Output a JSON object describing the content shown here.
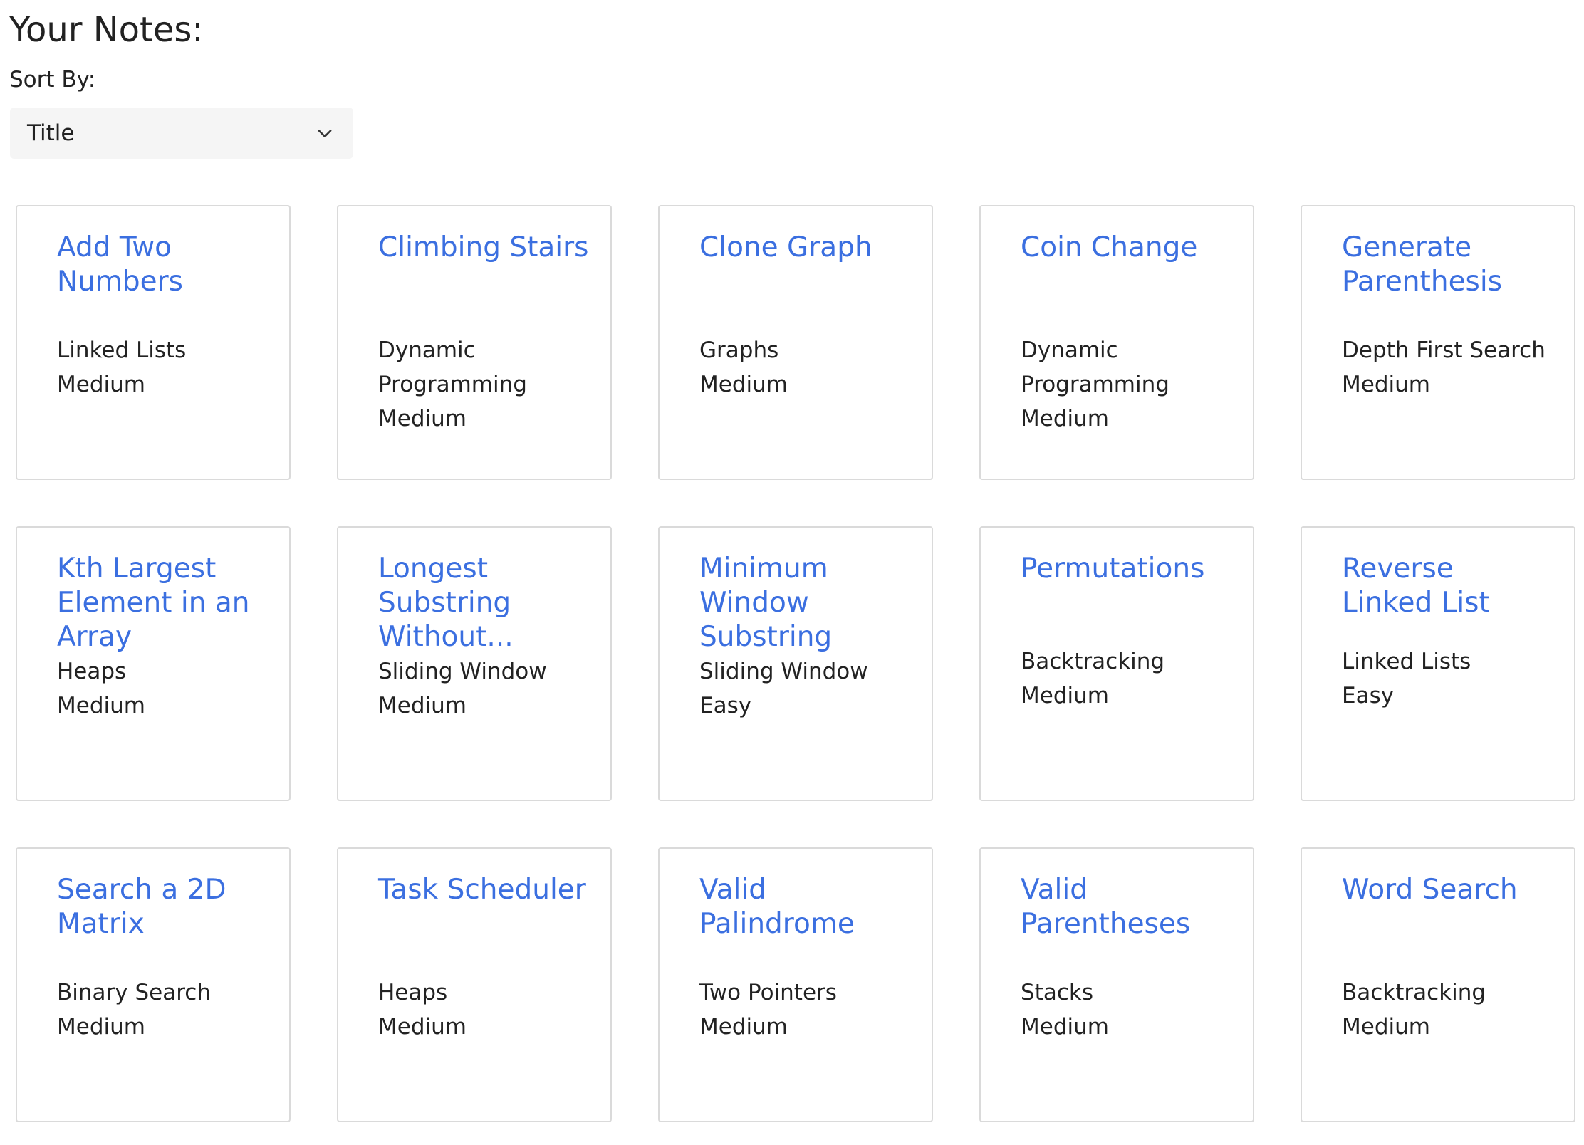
{
  "header": {
    "title": "Your Notes:",
    "sort_label": "Sort By:",
    "sort_value": "Title",
    "sort_icon": "chevron-down-icon"
  },
  "colors": {
    "link": "#3b6fe0",
    "text": "#222222",
    "card_border": "#dadada",
    "select_bg": "#f5f5f5"
  },
  "notes": [
    {
      "title": "Add Two Numbers",
      "category": "Linked Lists",
      "difficulty": "Medium"
    },
    {
      "title": "Climbing Stairs",
      "category": "Dynamic Programming",
      "difficulty": "Medium"
    },
    {
      "title": "Clone Graph",
      "category": "Graphs",
      "difficulty": "Medium"
    },
    {
      "title": "Coin Change",
      "category": "Dynamic Programming",
      "difficulty": "Medium"
    },
    {
      "title": "Generate Parenthesis",
      "category": "Depth First Search",
      "difficulty": "Medium"
    },
    {
      "title": "Kth Largest Element in an Array",
      "category": "Heaps",
      "difficulty": "Medium"
    },
    {
      "title": "Longest Substring Without...",
      "category": "Sliding Window",
      "difficulty": "Medium"
    },
    {
      "title": "Minimum Window Substring",
      "category": "Sliding Window",
      "difficulty": "Easy"
    },
    {
      "title": "Permutations",
      "category": "Backtracking",
      "difficulty": "Medium"
    },
    {
      "title": "Reverse Linked List",
      "category": "Linked Lists",
      "difficulty": "Easy"
    },
    {
      "title": "Search a 2D Matrix",
      "category": "Binary Search",
      "difficulty": "Medium"
    },
    {
      "title": "Task Scheduler",
      "category": "Heaps",
      "difficulty": "Medium"
    },
    {
      "title": "Valid Palindrome",
      "category": "Two Pointers",
      "difficulty": "Medium"
    },
    {
      "title": "Valid Parentheses",
      "category": "Stacks",
      "difficulty": "Medium"
    },
    {
      "title": "Word Search",
      "category": "Backtracking",
      "difficulty": "Medium"
    }
  ]
}
